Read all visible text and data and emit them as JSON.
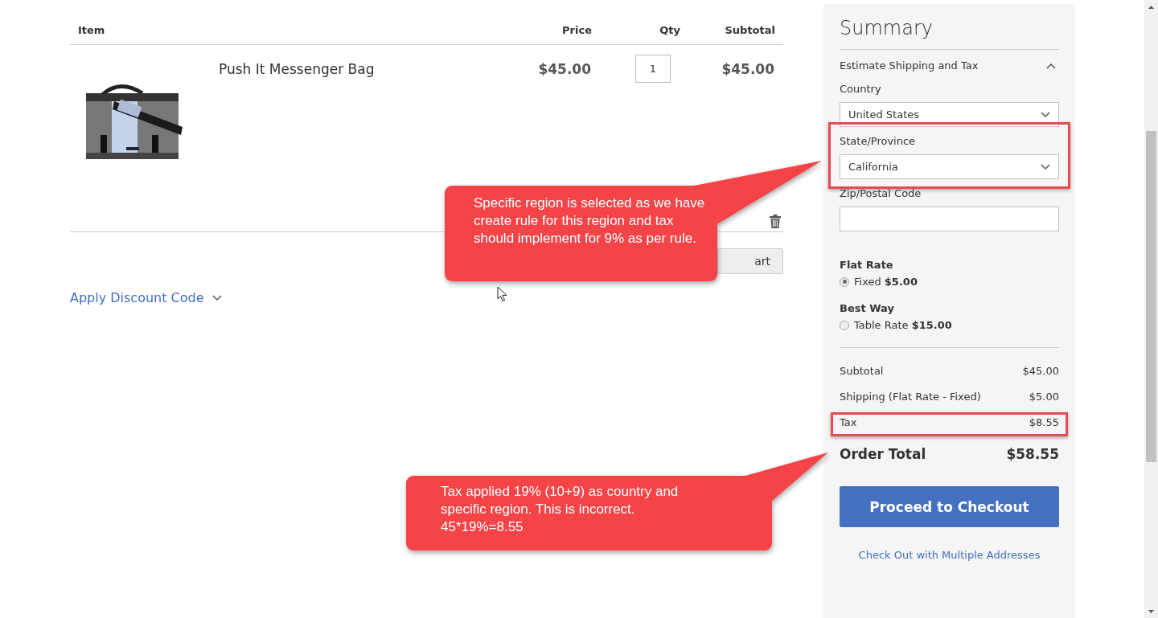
{
  "cart": {
    "columns": [
      "Item",
      "Price",
      "Qty",
      "Subtotal"
    ],
    "items": [
      {
        "kind": "picture",
        "name": "Push It Messenger Bag",
        "price": "$45.00",
        "qty": "1",
        "subtotal": "$45.00"
      }
    ],
    "update_button_visible_text": "art",
    "discount_link": "Apply Discount Code"
  },
  "summary": {
    "title": "Summary",
    "estimate": {
      "title": "Estimate Shipping and Tax",
      "expanded": true,
      "fields": [
        {
          "kind": "select",
          "label": "Country",
          "value": "United States",
          "highlighted": false
        },
        {
          "kind": "select",
          "label": "State/Province",
          "value": "California",
          "highlighted": true
        },
        {
          "kind": "input",
          "label": "Zip/Postal Code",
          "highlighted": false
        }
      ]
    },
    "shipping_methods": [
      {
        "carrier": "Flat Rate",
        "method": "Fixed",
        "price": "$5.00",
        "selected": true
      },
      {
        "carrier": "Best Way",
        "method": "Table Rate",
        "price": "$15.00",
        "selected": false
      }
    ],
    "totals": [
      {
        "label": "Subtotal",
        "value": "$45.00",
        "highlighted": false
      },
      {
        "label": "Shipping (Flat Rate - Fixed)",
        "value": "$5.00",
        "highlighted": false
      },
      {
        "label": "Tax",
        "value": "$8.55",
        "highlighted": true
      }
    ],
    "order_total": {
      "label": "Order Total",
      "value": "$58.55"
    },
    "checkout_button": "Proceed to Checkout",
    "multi_address_link": "Check Out with Multiple Addresses"
  },
  "annotations": [
    {
      "text": "Specific region is selected as we have create rule for this region and tax should implement for 9% as per rule."
    },
    {
      "text": "Tax applied 19% (10+9) as country and specific region. This is incorrect. 45*19%=8.55"
    }
  ]
}
